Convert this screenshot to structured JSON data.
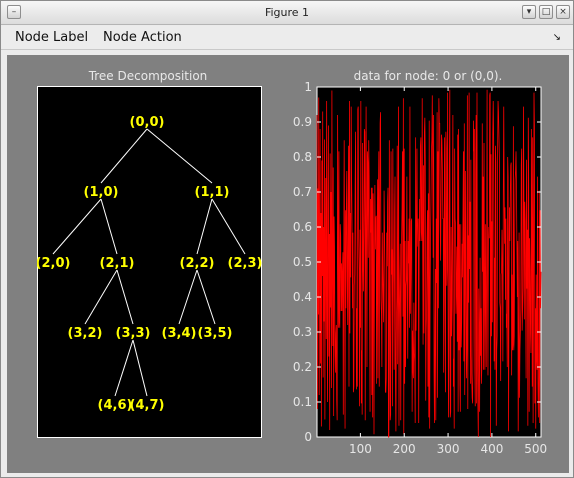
{
  "window": {
    "title": "Figure 1",
    "buttons": {
      "menu": "–",
      "minimize": "▾",
      "maximize": "□",
      "close": "×"
    }
  },
  "menubar": {
    "items": [
      "Node Label",
      "Node Action"
    ],
    "dock_icon": "↘"
  },
  "tree_axes": {
    "title": "Tree Decomposition",
    "nodes": [
      {
        "label": "(0,0)",
        "parent": null
      },
      {
        "label": "(1,0)",
        "parent": "(0,0)"
      },
      {
        "label": "(1,1)",
        "parent": "(0,0)"
      },
      {
        "label": "(2,0)",
        "parent": "(1,0)"
      },
      {
        "label": "(2,1)",
        "parent": "(1,0)"
      },
      {
        "label": "(2,2)",
        "parent": "(1,1)"
      },
      {
        "label": "(2,3)",
        "parent": "(1,1)"
      },
      {
        "label": "(3,2)",
        "parent": "(2,1)"
      },
      {
        "label": "(3,3)",
        "parent": "(2,1)"
      },
      {
        "label": "(3,4)",
        "parent": "(2,2)"
      },
      {
        "label": "(3,5)",
        "parent": "(2,2)"
      },
      {
        "label": "(4,6)",
        "parent": "(3,3)"
      },
      {
        "label": "(4,7)",
        "parent": "(3,3)"
      }
    ],
    "colors": {
      "background": "#000000",
      "edge": "#ffffff",
      "label": "#ffff00"
    }
  },
  "signal_axes": {
    "title": "data for node: 0 or (0,0)."
  },
  "chart_data": {
    "type": "line",
    "title": "data for node: 0 or (0,0).",
    "xlabel": "",
    "ylabel": "",
    "xlim": [
      1,
      512
    ],
    "ylim": [
      0,
      1
    ],
    "x_ticks": [
      100,
      200,
      300,
      400,
      500
    ],
    "y_ticks": [
      0,
      0.1,
      0.2,
      0.3,
      0.4,
      0.5,
      0.6,
      0.7,
      0.8,
      0.9,
      1
    ],
    "grid": false,
    "series": [
      {
        "color": "#ff0000",
        "n_points": 512,
        "description_values": "dense random-like signal uniformly spread between 0 and 1",
        "values": [
          0.92,
          0.08,
          0.71,
          0.35,
          0.97,
          0.12,
          0.55,
          0.88,
          0.21,
          0.64,
          0.03,
          0.79,
          0.46,
          0.93,
          0.17,
          0.6,
          0.33,
          0.85,
          0.05,
          0.52,
          0.74,
          0.28,
          0.96,
          0.41,
          0.1,
          0.67,
          0.89,
          0.23,
          0.58,
          0.02,
          0.81,
          0.37,
          0.7,
          0.14,
          0.99,
          0.48,
          0.26,
          0.77,
          0.06,
          0.63
        ]
      }
    ]
  }
}
